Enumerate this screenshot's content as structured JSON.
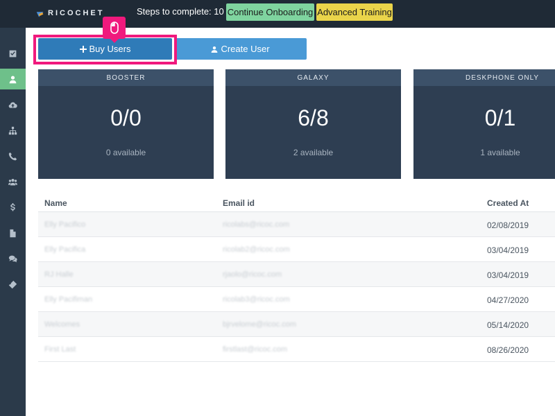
{
  "header": {
    "logo_text": "RICOCHET",
    "steps_label": "Steps to complete: 10",
    "continue_onboarding": "Continue Onboarding",
    "advanced_training": "Advanced Training"
  },
  "sidebar": {
    "items": [
      {
        "icon": "checkbox-icon",
        "active": false
      },
      {
        "icon": "user-icon",
        "active": true
      },
      {
        "icon": "cloud-upload-icon",
        "active": false
      },
      {
        "icon": "org-chart-icon",
        "active": false
      },
      {
        "icon": "phone-icon",
        "active": false
      },
      {
        "icon": "group-icon",
        "active": false
      },
      {
        "icon": "dollar-icon",
        "active": false
      },
      {
        "icon": "file-icon",
        "active": false
      },
      {
        "icon": "chat-icon",
        "active": false
      },
      {
        "icon": "ticket-icon",
        "active": false
      }
    ]
  },
  "actions": {
    "buy_users": "Buy Users",
    "create_user": "Create User"
  },
  "cards": [
    {
      "title": "BOOSTER",
      "value": "0/0",
      "available": "0 available"
    },
    {
      "title": "GALAXY",
      "value": "6/8",
      "available": "2 available"
    },
    {
      "title": "DESKPHONE ONLY",
      "value": "0/1",
      "available": "1 available"
    }
  ],
  "table": {
    "columns": [
      "Name",
      "Email id",
      "Created At"
    ],
    "rows": [
      {
        "name": "Elly Pacifico",
        "email": "ricolabs@ricoc.com",
        "created_at": "02/08/2019"
      },
      {
        "name": "Elly Pacifica",
        "email": "ricolab2@ricoc.com",
        "created_at": "03/04/2019"
      },
      {
        "name": "RJ Halle",
        "email": "rjaolo@ricoc.com",
        "created_at": "03/04/2019"
      },
      {
        "name": "Elly Pacifiman",
        "email": "ricolab3@ricoc.com",
        "created_at": "04/27/2020"
      },
      {
        "name": "Welcomes",
        "email": "bjrvelome@ricoc.com",
        "created_at": "05/14/2020"
      },
      {
        "name": "First Last",
        "email": "firstlast@ricoc.com",
        "created_at": "08/26/2020"
      }
    ]
  },
  "colors": {
    "topbar": "#1f2a36",
    "sidebar": "#2b3a4a",
    "active_nav": "#6ec08a",
    "highlight": "#f0197d",
    "card": "#2e3e52"
  }
}
